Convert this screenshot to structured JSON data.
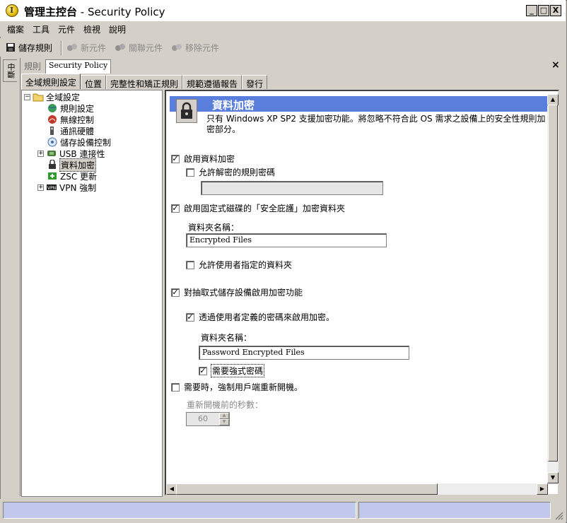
{
  "window": {
    "title_main": "管理主控台",
    "title_sep": " - ",
    "title_sub": "Security Policy",
    "min_label": "_",
    "max_label": "□",
    "close_label": "X"
  },
  "menu": [
    "檔案",
    "工具",
    "元件",
    "檢視",
    "說明"
  ],
  "toolbar": {
    "save_label": "儲存規則",
    "new_label": "新元件",
    "link_label": "關聯元件",
    "remove_label": "移除元件"
  },
  "side_tab": "中斷",
  "doc_tabs": {
    "rules": "規則",
    "policy": "Security Policy",
    "close": "×"
  },
  "subtabs": [
    "全域規則設定",
    "位置",
    "完整性和矯正規則",
    "規範遵循報告",
    "發行"
  ],
  "tree": {
    "root": "全域設定",
    "items": [
      {
        "label": "規則設定",
        "icon": "globe-icon",
        "color": "#2e8b57"
      },
      {
        "label": "無線控制",
        "icon": "wireless-icon",
        "color": "#c0392b"
      },
      {
        "label": "通訊硬體",
        "icon": "hardware-icon",
        "color": "#555555"
      },
      {
        "label": "儲存設備控制",
        "icon": "storage-icon",
        "color": "#3a6fb0"
      },
      {
        "label": "USB 連接性",
        "icon": "usb-icon",
        "color": "#4a7a3a"
      },
      {
        "label": "資料加密",
        "icon": "lock-icon",
        "color": "#333333"
      },
      {
        "label": "ZSC 更新",
        "icon": "update-icon",
        "color": "#2e9a2e"
      },
      {
        "label": "VPN 強制",
        "icon": "vpn-icon",
        "color": "#222222"
      }
    ]
  },
  "panel": {
    "header": "資料加密",
    "description": "只有 Windows XP SP2 支援加密功能。將忽略不符合此 OS 需求之設備上的安全性規則加密部分。",
    "enable_encryption": "啟用資料加密",
    "allow_decrypt_password": "允許解密的規則密碼",
    "decrypt_password_value": "",
    "enable_safe_harbor": "啟用固定式磁碟的「安全庇護」加密資料夾",
    "folder_name_label": "資料夾名稱：",
    "folder_name_value": "Encrypted Files",
    "allow_user_folders": "允許使用者指定的資料夾",
    "removable_encryption": "對抽取式儲存設備啟用加密功能",
    "user_password_encryption": "透過使用者定義的密碼來啟用加密。",
    "folder_name_label2": "資料夾名稱：",
    "folder_name_value2": "Password Encrypted Files",
    "require_strong_password": "需要強式密碼",
    "force_reboot": "需要時，強制用戶端重新開機。",
    "seconds_before_reboot": "重新開機前的秒數：",
    "seconds_value": "60"
  },
  "checks": {
    "enable_encryption": true,
    "allow_decrypt_password": false,
    "enable_safe_harbor": true,
    "allow_user_folders": false,
    "removable_encryption": true,
    "user_password_encryption": true,
    "require_strong_password": true,
    "force_reboot": false
  },
  "colors": {
    "header_bar": "#5a7edc",
    "status_panel": "#c2c8ec",
    "chrome": "#d4d0c8"
  }
}
